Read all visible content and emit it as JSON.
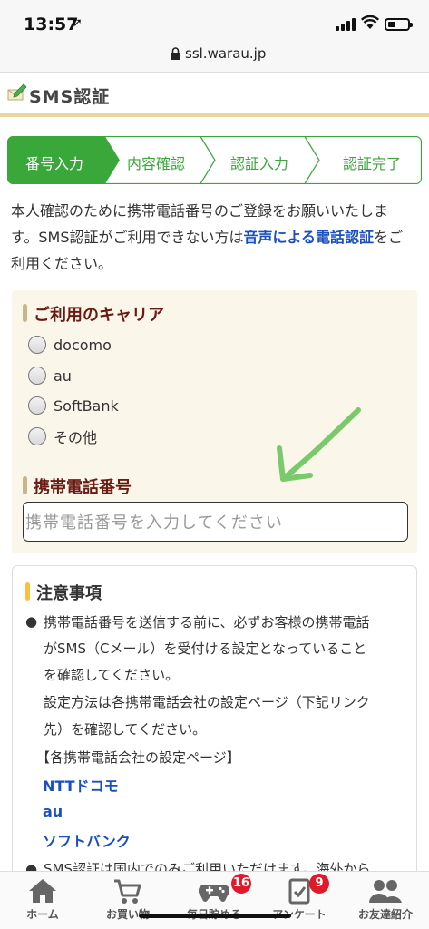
{
  "status_bar": {
    "time": "13:57"
  },
  "browser": {
    "url": "ssl.warau.jp"
  },
  "header": {
    "title": "SMS認証"
  },
  "steps": [
    {
      "label": "番号入力",
      "active": true
    },
    {
      "label": "内容確認",
      "active": false
    },
    {
      "label": "認証入力",
      "active": false
    },
    {
      "label": "認証完了",
      "active": false
    }
  ],
  "intro": {
    "line1": "本人確認のために携帯電話番号のご登録をお願いいたしま",
    "line2a": "す。SMS認証がご利用できない方は",
    "link": "音声による電話認証",
    "line2b": "をご",
    "line3": "利用ください。"
  },
  "carrier": {
    "heading": "ご利用のキャリア",
    "options": [
      "docomo",
      "au",
      "SoftBank",
      "その他"
    ]
  },
  "phone": {
    "heading": "携帯電話番号",
    "placeholder": "携帯電話番号を入力してください"
  },
  "notes": {
    "heading": "注意事項",
    "b1_l1": "携帯電話番号を送信する前に、必ずお客様の携帯電話",
    "b1_l2": "がSMS（Cメール）を受付ける設定となっていること",
    "b1_l3": "を確認してください。",
    "b1_l4": "設定方法は各携帯電話会社の設定ページ（下記リンク",
    "b1_l5": "先）を確認してください。",
    "b1_l6": "【各携帯電話会社の設定ページ】",
    "links": [
      "NTTドコモ",
      "au",
      "ソフトバンク"
    ],
    "b2": "SMS認証は国内でのみご利用いただけます。海外から"
  },
  "tabbar": {
    "tabs": [
      {
        "label": "ホーム",
        "icon": "home-icon"
      },
      {
        "label": "お買い物",
        "icon": "cart-icon"
      },
      {
        "label": "毎日貯める",
        "icon": "gamepad-icon",
        "badge": "16"
      },
      {
        "label": "アンケート",
        "icon": "survey-icon",
        "badge": "9"
      },
      {
        "label": "お友達紹介",
        "icon": "friends-icon"
      }
    ]
  },
  "colors": {
    "accent_green": "#3aa73a",
    "link_blue": "#1a4fc2",
    "heading_red": "#6b1a12",
    "badge_red": "#e0192b"
  }
}
